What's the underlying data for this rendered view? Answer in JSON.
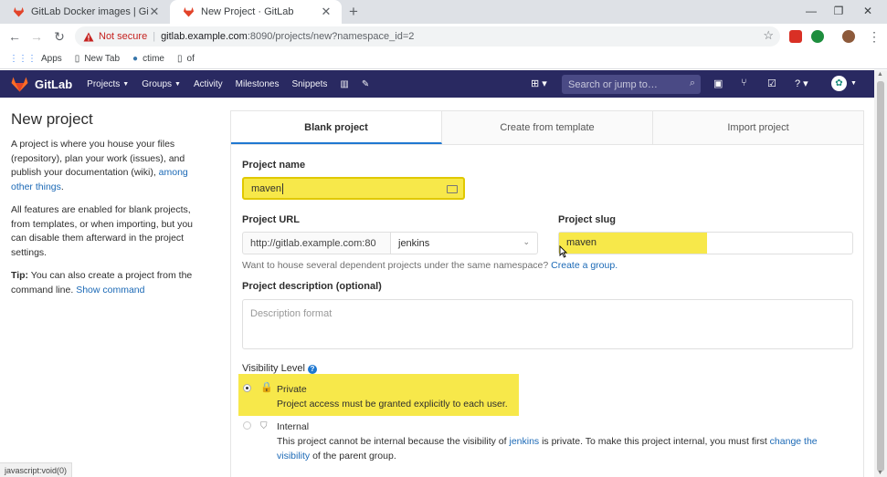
{
  "browser": {
    "tabs": [
      {
        "title": "GitLab Docker images | GitLab",
        "active": false
      },
      {
        "title": "New Project · GitLab",
        "active": true
      }
    ],
    "security_label": "Not secure",
    "url_host": "gitlab.example.com",
    "url_path": ":8090/projects/new?namespace_id=2",
    "bookmarks": [
      "Apps",
      "New Tab",
      "ctime",
      "of"
    ],
    "status_text": "javascript:void(0)"
  },
  "gitlab_nav": {
    "brand": "GitLab",
    "items": [
      "Projects",
      "Groups",
      "Activity",
      "Milestones",
      "Snippets"
    ],
    "search_placeholder": "Search or jump to…",
    "brand_color": "#292961"
  },
  "sidebar": {
    "title": "New project",
    "para1_text": "A project is where you house your files (repository), plan your work (issues), and publish your documentation (wiki), ",
    "para1_link": "among other things",
    "para1_end": ".",
    "para2": "All features are enabled for blank projects, from templates, or when importing, but you can disable them afterward in the project settings.",
    "tip_label": "Tip:",
    "tip_text": " You can also create a project from the command line. ",
    "tip_link": "Show command"
  },
  "project_tabs": [
    "Blank project",
    "Create from template",
    "Import project"
  ],
  "form": {
    "name_label": "Project name",
    "name_value": "maven",
    "url_label": "Project URL",
    "url_prefix": "http://gitlab.example.com:80",
    "namespace_value": "jenkins",
    "slug_label": "Project slug",
    "slug_value": "maven",
    "group_help": "Want to house several dependent projects under the same namespace? ",
    "group_link": "Create a group.",
    "desc_label": "Project description (optional)",
    "desc_placeholder": "Description format",
    "visibility_label": "Visibility Level",
    "visibility_options": [
      {
        "title": "Private",
        "desc": "Project access must be granted explicitly to each user.",
        "selected": true
      },
      {
        "title": "Internal",
        "desc_a": "This project cannot be internal because the visibility of ",
        "desc_link1": "jenkins",
        "desc_b": " is private. To make this project internal, you must first ",
        "desc_link2": "change the visibility",
        "desc_c": " of the parent group.",
        "selected": false
      }
    ]
  },
  "colors": {
    "highlight": "#f7e84a",
    "link": "#1b69b6",
    "active_tab_underline": "#1f78d1"
  }
}
